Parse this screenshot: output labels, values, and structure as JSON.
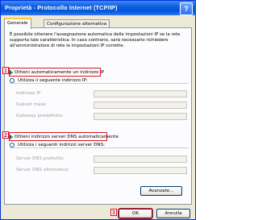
{
  "window": {
    "title": "Proprietà - Protocollo Internet (TCP/IP)",
    "help_label": "?"
  },
  "tabs": [
    {
      "label": "Generale",
      "active": true
    },
    {
      "label": "Configurazione alternativa",
      "active": false
    }
  ],
  "description": "È possibile ottenere l'assegnazione automatica delle impostazioni IP se la rete supporta tale caratteristica. In caso contrario, sarà necessario richiedere all'amministratore di rete le impostazioni IP corrette.",
  "ip": {
    "auto_label": "Ottieni automaticamente un indirizzo IP",
    "manual_label": "Utilizza il seguente indirizzo IP:",
    "address_label": "Indirizzo IP:",
    "mask_label": "Subnet mask:",
    "gateway_label": "Gateway predefinito:"
  },
  "dns": {
    "auto_label": "Ottieni indirizzo server DNS automaticamente",
    "manual_label": "Utilizza i seguenti indirizzi server DNS:",
    "preferred_label": "Server DNS preferito:",
    "alternate_label": "Server DNS alternativo:"
  },
  "buttons": {
    "advanced": "Avanzate...",
    "ok": "OK",
    "cancel": "Annulla"
  },
  "annotations": [
    "1",
    "2",
    "3"
  ],
  "colors": {
    "title_bar": "#0654d8",
    "annotation_red": "#e0141e",
    "dialog_bg": "#ece9d8"
  }
}
